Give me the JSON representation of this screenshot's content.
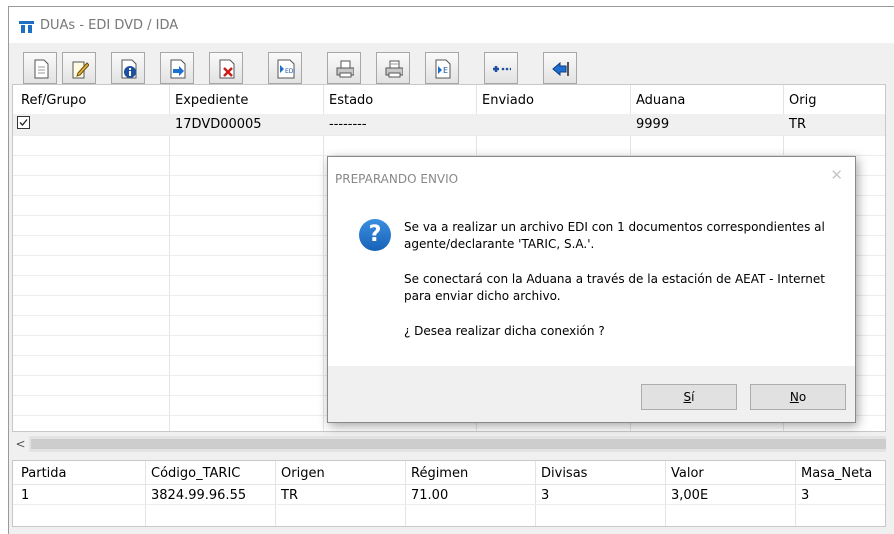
{
  "window": {
    "title": "DUAs - EDI DVD / IDA"
  },
  "toolbar": {
    "buttons": [
      {
        "name": "new-document-icon"
      },
      {
        "name": "edit-document-icon"
      },
      {
        "name": "info-icon"
      },
      {
        "name": "export-icon"
      },
      {
        "name": "delete-document-icon"
      },
      {
        "name": "edi-send-icon"
      },
      {
        "name": "print-icon"
      },
      {
        "name": "print-preview-icon"
      },
      {
        "name": "import-edi-icon"
      },
      {
        "name": "more-icon"
      },
      {
        "name": "back-icon"
      }
    ]
  },
  "main_grid": {
    "columns": [
      "Ref/Grupo",
      "Expediente",
      "Estado",
      "Enviado",
      "Aduana",
      "Orig"
    ],
    "rows": [
      {
        "ref_checked": true,
        "expediente": "17DVD00005",
        "estado": "--------",
        "enviado": "",
        "aduana": "9999",
        "orig": "TR"
      }
    ]
  },
  "scroll": {
    "left_arrow": "<"
  },
  "detail_grid": {
    "columns": [
      "Partida",
      "Código_TARIC",
      "Origen",
      "Régimen",
      "Divisas",
      "Valor",
      "Masa_Neta"
    ],
    "rows": [
      {
        "partida": "1",
        "codigo": "3824.99.96.55",
        "origen": "TR",
        "regimen": "71.00",
        "divisas": "3",
        "valor": "3,00E",
        "masa": "3"
      }
    ]
  },
  "dialog": {
    "title": "PREPARANDO ENVIO",
    "close": "✕",
    "icon": "?",
    "line1": "Se va a realizar un archivo EDI con 1 documentos correspondientes al",
    "line2": "agente/declarante 'TARIC, S.A.'.",
    "line3": "Se conectará con la Aduana a través de la estación de AEAT - Internet",
    "line4": "para enviar dicho archivo.",
    "line5": "¿ Desea realizar dicha conexión ?",
    "yes_mnemonic": "S",
    "yes_rest": "í",
    "no_mnemonic": "N",
    "no_rest": "o"
  }
}
